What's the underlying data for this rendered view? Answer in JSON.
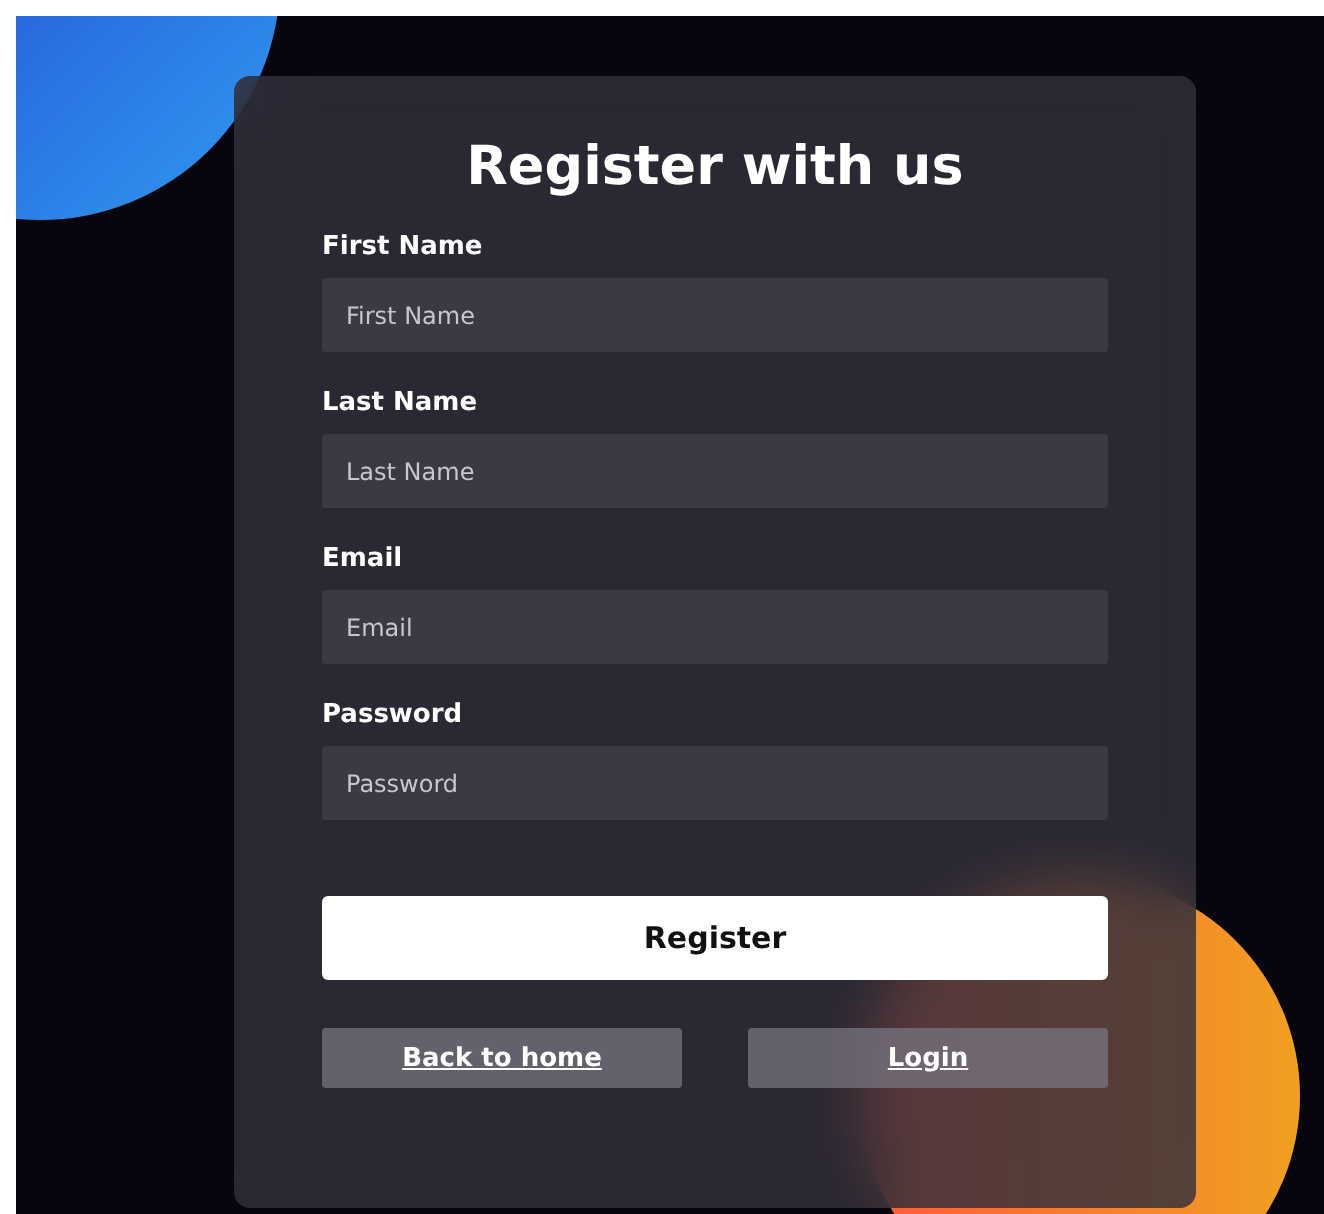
{
  "form": {
    "title": "Register with us",
    "fields": [
      {
        "label": "First Name",
        "placeholder": "First Name"
      },
      {
        "label": "Last Name",
        "placeholder": "Last Name"
      },
      {
        "label": "Email",
        "placeholder": "Email"
      },
      {
        "label": "Password",
        "placeholder": "Password"
      }
    ],
    "submit_button": "Register",
    "links": [
      "Back to home",
      "Login"
    ]
  }
}
